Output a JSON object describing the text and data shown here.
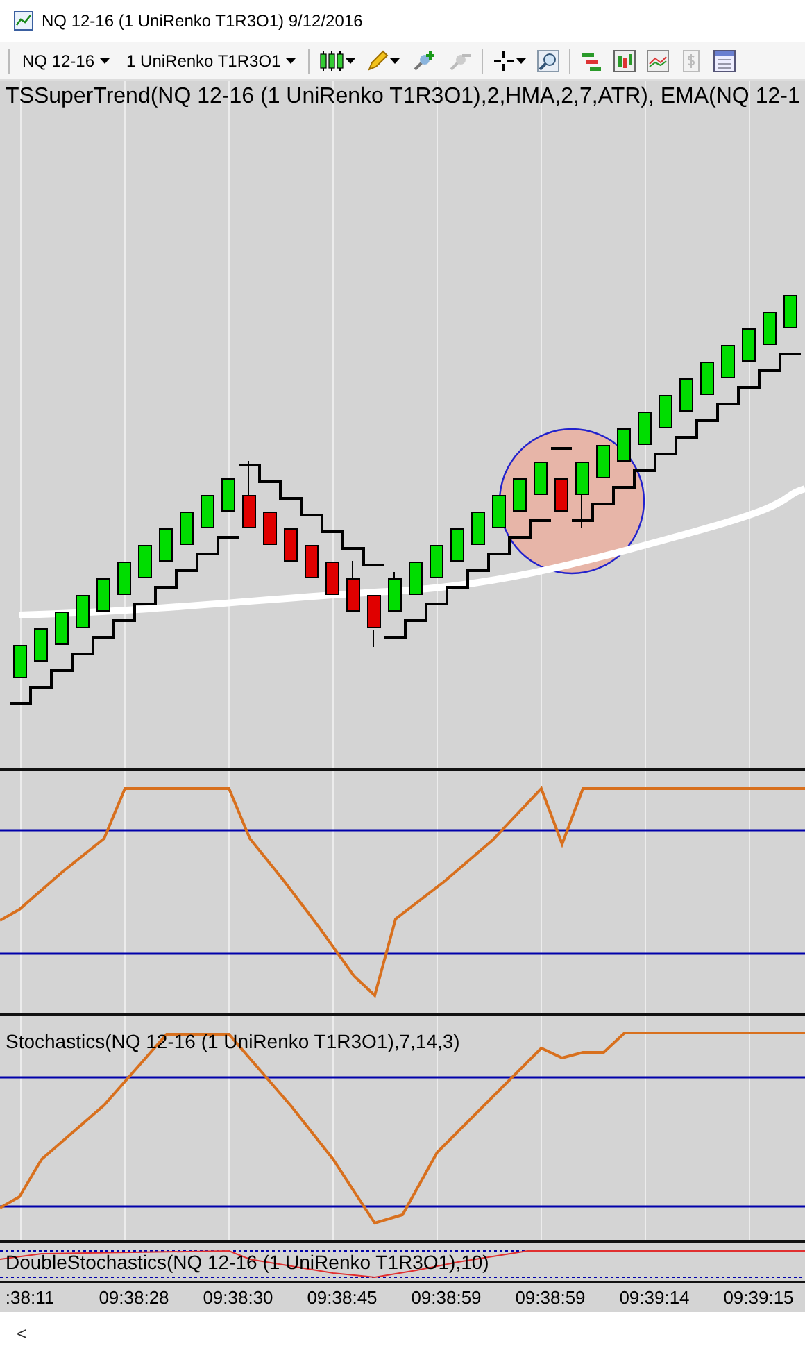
{
  "window": {
    "title": "NQ 12-16 (1 UniRenko T1R3O1)  9/12/2016"
  },
  "toolbar": {
    "instrument": "NQ 12-16",
    "period": "1 UniRenko T1R3O1"
  },
  "panels": [
    {
      "label": "TSSuperTrend(NQ 12-16 (1 UniRenko T1R3O1),2,HMA,2,7,ATR), EMA(NQ 12-1"
    },
    {
      "label": "Stochastics(NQ 12-16 (1 UniRenko T1R3O1),7,14,3)"
    },
    {
      "label": "DoubleStochastics(NQ 12-16 (1 UniRenko T1R3O1),10)"
    }
  ],
  "x_axis": [
    ":38:11",
    "09:38:28",
    "09:38:30",
    "09:38:45",
    "09:38:59",
    "09:38:59",
    "09:39:14",
    "09:39:15"
  ],
  "scroll_bar": {
    "left_arrow": "<"
  }
}
